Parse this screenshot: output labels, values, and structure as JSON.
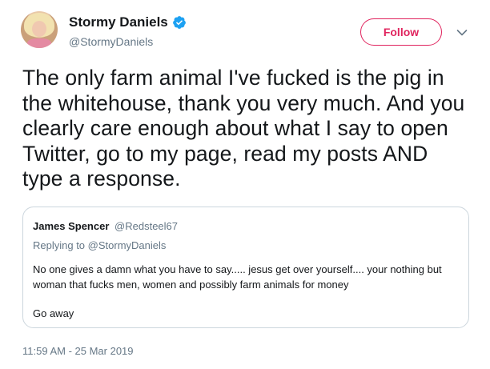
{
  "author": {
    "display_name": "Stormy Daniels",
    "handle": "@StormyDaniels",
    "verified": true
  },
  "follow_button": {
    "label": "Follow",
    "color": "#e0245e"
  },
  "tweet": {
    "text": "The only farm animal I've fucked is the pig in the whitehouse, thank you very much. And you clearly care enough about what I say to open Twitter, go to my page, read my posts AND type a response."
  },
  "quoted_tweet": {
    "display_name": "James Spencer",
    "handle": "@Redsteel67",
    "replying_to_label": "Replying to",
    "replying_to_handle": "@StormyDaniels",
    "body": "No one gives a damn what you have to say..... jesus get over yourself.... your nothing but woman that fucks men, women and possibly farm animals for money",
    "body2": "Go away"
  },
  "timestamp": "11:59 AM - 25 Mar 2019",
  "icons": {
    "verified": "verified-badge-icon",
    "menu": "chevron-down-icon"
  },
  "colors": {
    "text": "#14171a",
    "secondary": "#657786",
    "verified": "#1da1f2",
    "border": "#ccd6dd"
  }
}
